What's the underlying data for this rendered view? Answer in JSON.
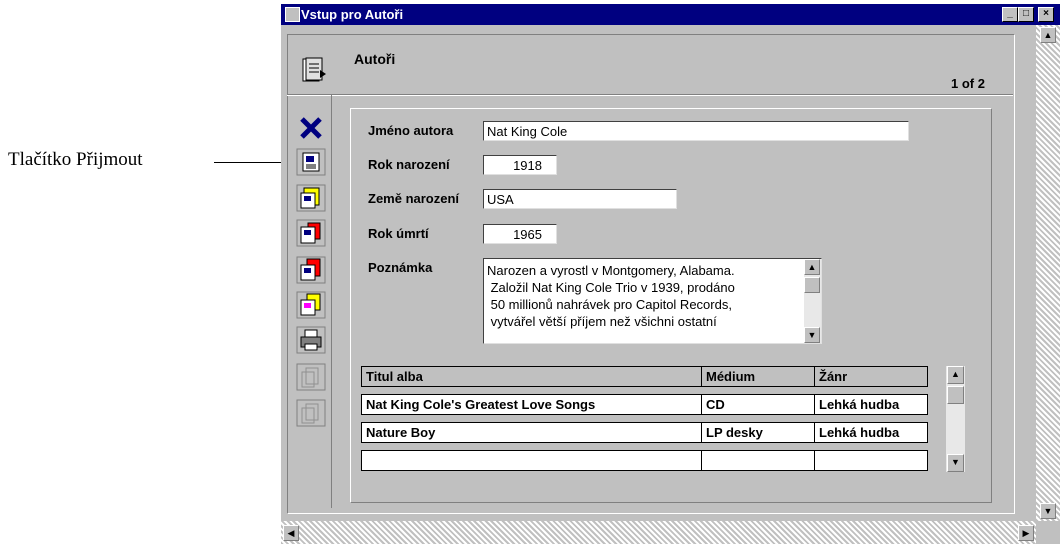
{
  "callout": {
    "label": "Tlačítko Přijmout"
  },
  "window": {
    "title": "Vstup pro Autoři",
    "minimize_glyph": "_",
    "maximize_glyph": "□",
    "close_glyph": "×"
  },
  "form": {
    "title": "Autoři",
    "record_count": "1 of 2"
  },
  "toolbar": {
    "buttons": [
      {
        "name": "delete-icon"
      },
      {
        "name": "accept-icon"
      },
      {
        "name": "record-icon"
      },
      {
        "name": "record-icon"
      },
      {
        "name": "record-icon"
      },
      {
        "name": "record-icon"
      },
      {
        "name": "print-icon"
      },
      {
        "name": "disabled-record-icon"
      },
      {
        "name": "disabled-record-icon"
      }
    ]
  },
  "fields": {
    "author_label": "Jméno autora",
    "author_value": "Nat King Cole",
    "birth_year_label": "Rok narození",
    "birth_year_value": "1918",
    "birth_country_label": "Země narození",
    "birth_country_value": "USA",
    "death_year_label": "Rok úmrtí",
    "death_year_value": "1965",
    "note_label": "Poznámka",
    "note_lines": [
      "Narozen a vyrostl v Montgomery, Alabama.",
      " Založil Nat King Cole Trio v 1939, prodáno",
      " 50 millionů nahrávek pro Capitol Records,",
      " vytvářel větší příjem než všichni ostatní"
    ]
  },
  "albums": {
    "columns": [
      "Titul alba",
      "Médium",
      "Žánr"
    ],
    "rows": [
      [
        "Nat King Cole's Greatest Love Songs",
        "CD",
        "Lehká hudba"
      ],
      [
        "Nature Boy",
        "LP desky",
        "Lehká hudba"
      ],
      [
        "",
        "",
        ""
      ]
    ]
  },
  "colors": {
    "titlebar": "#000080",
    "window_face": "#c0c0c0"
  }
}
